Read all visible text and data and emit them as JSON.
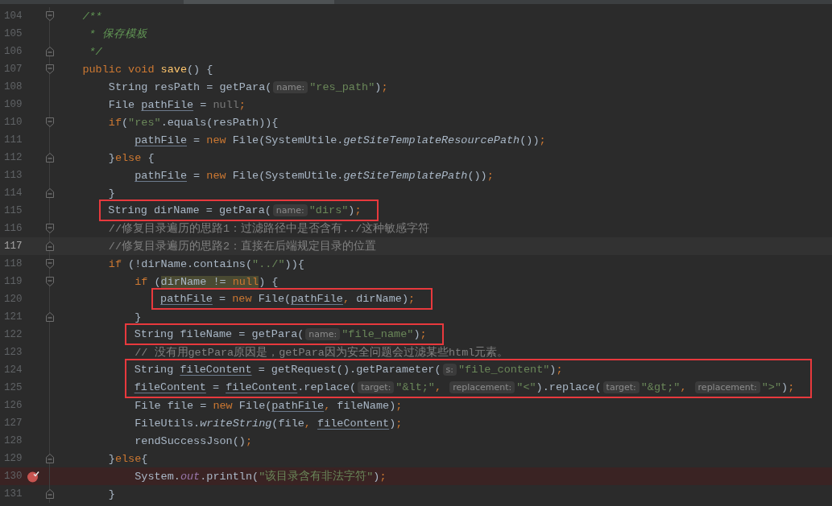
{
  "lines": [
    {
      "kind": "line",
      "number": "104",
      "fold_start": true,
      "fold_end": false,
      "current": false,
      "breakpoint": false,
      "tokens": [
        {
          "text": "/**",
          "kind": "doc"
        }
      ]
    },
    {
      "kind": "line",
      "number": "105",
      "fold_start": false,
      "fold_end": false,
      "current": false,
      "breakpoint": false,
      "tokens": [
        {
          "text": " * 保存模板",
          "kind": "doc"
        }
      ]
    },
    {
      "kind": "line",
      "number": "106",
      "fold_start": false,
      "fold_end": true,
      "current": false,
      "breakpoint": false,
      "tokens": [
        {
          "text": " */",
          "kind": "doc"
        }
      ]
    },
    {
      "kind": "line",
      "number": "107",
      "fold_start": true,
      "fold_end": false,
      "current": false,
      "breakpoint": false,
      "tokens": [
        {
          "text": "public void ",
          "kind": "keyword"
        },
        {
          "text": "save",
          "kind": "decl"
        },
        {
          "text": "() {",
          "kind": "plain"
        }
      ],
      "children": [
        {
          "kind": "line",
          "number": "108",
          "fold_start": false,
          "fold_end": false,
          "current": false,
          "breakpoint": false,
          "tokens": [
            {
              "text": "String resPath = getPara(",
              "kind": "plain"
            },
            {
              "text": "name:",
              "kind": "hint"
            },
            {
              "text": "\"res_path\"",
              "kind": "string"
            },
            {
              "text": ")",
              "kind": "plain"
            },
            {
              "text": ";",
              "kind": "punct"
            }
          ]
        },
        {
          "kind": "line",
          "number": "109",
          "fold_start": false,
          "fold_end": false,
          "current": false,
          "breakpoint": false,
          "tokens": [
            {
              "text": "File ",
              "kind": "plain"
            },
            {
              "text": "pathFile",
              "kind": "var"
            },
            {
              "text": " = ",
              "kind": "plain"
            },
            {
              "text": "null",
              "kind": "unused"
            },
            {
              "text": ";",
              "kind": "punct"
            }
          ]
        },
        {
          "kind": "line",
          "number": "110",
          "fold_start": true,
          "fold_end": false,
          "current": false,
          "breakpoint": false,
          "tokens": [
            {
              "text": "if",
              "kind": "keyword"
            },
            {
              "text": "(",
              "kind": "plain"
            },
            {
              "text": "\"res\"",
              "kind": "string"
            },
            {
              "text": ".equals(resPath)){",
              "kind": "plain"
            }
          ],
          "children": [
            {
              "kind": "line",
              "number": "111",
              "fold_start": false,
              "fold_end": false,
              "current": false,
              "breakpoint": false,
              "tokens": [
                {
                  "text": "pathFile",
                  "kind": "var"
                },
                {
                  "text": " = ",
                  "kind": "plain"
                },
                {
                  "text": "new ",
                  "kind": "keyword"
                },
                {
                  "text": "File(SystemUtile.",
                  "kind": "plain"
                },
                {
                  "text": "getSiteTemplateResourcePath",
                  "kind": "italic"
                },
                {
                  "text": "())",
                  "kind": "plain"
                },
                {
                  "text": ";",
                  "kind": "punct"
                }
              ]
            }
          ]
        },
        {
          "kind": "line",
          "number": "112",
          "fold_start": false,
          "fold_end": true,
          "current": false,
          "breakpoint": false,
          "tokens": [
            {
              "text": "}",
              "kind": "plain"
            },
            {
              "text": "else",
              "kind": "keyword"
            },
            {
              "text": " {",
              "kind": "plain"
            }
          ],
          "children": [
            {
              "kind": "line",
              "number": "113",
              "fold_start": false,
              "fold_end": false,
              "current": false,
              "breakpoint": false,
              "tokens": [
                {
                  "text": "pathFile",
                  "kind": "var"
                },
                {
                  "text": " = ",
                  "kind": "plain"
                },
                {
                  "text": "new ",
                  "kind": "keyword"
                },
                {
                  "text": "File(SystemUtile.",
                  "kind": "plain"
                },
                {
                  "text": "getSiteTemplatePath",
                  "kind": "italic"
                },
                {
                  "text": "())",
                  "kind": "plain"
                },
                {
                  "text": ";",
                  "kind": "punct"
                }
              ]
            }
          ]
        },
        {
          "kind": "line",
          "number": "114",
          "fold_start": false,
          "fold_end": true,
          "current": false,
          "breakpoint": false,
          "tokens": [
            {
              "text": "}",
              "kind": "plain"
            }
          ]
        },
        {
          "kind": "boxed",
          "lines": [
            {
              "number": "115",
              "fold_start": false,
              "fold_end": false,
              "current": false,
              "breakpoint": false,
              "tokens": [
                {
                  "text": "String dirName = getPara(",
                  "kind": "plain"
                },
                {
                  "text": "name:",
                  "kind": "hint"
                },
                {
                  "text": "\"dirs\"",
                  "kind": "string"
                },
                {
                  "text": ")",
                  "kind": "plain"
                },
                {
                  "text": ";",
                  "kind": "punct"
                }
              ]
            }
          ]
        },
        {
          "kind": "line",
          "number": "116",
          "fold_start": true,
          "fold_end": false,
          "current": false,
          "breakpoint": false,
          "tokens": [
            {
              "text": "//修复目录遍历的思路1：过滤路径中是否含有../这种敏感字符",
              "kind": "comment"
            }
          ]
        },
        {
          "kind": "line",
          "number": "117",
          "fold_start": false,
          "fold_end": true,
          "current": true,
          "breakpoint": false,
          "tokens": [
            {
              "text": "//修复目录遍历的思路2：直接在后端规定目录的位置",
              "kind": "comment"
            }
          ]
        },
        {
          "kind": "line",
          "number": "118",
          "fold_start": true,
          "fold_end": false,
          "current": false,
          "breakpoint": false,
          "tokens": [
            {
              "text": "if",
              "kind": "keyword"
            },
            {
              "text": " (!dirName.contains(",
              "kind": "plain"
            },
            {
              "text": "\"../\"",
              "kind": "string"
            },
            {
              "text": ")){",
              "kind": "plain"
            }
          ],
          "children": [
            {
              "kind": "line",
              "number": "119",
              "fold_start": true,
              "fold_end": false,
              "current": false,
              "breakpoint": false,
              "tokens": [
                {
                  "text": "if",
                  "kind": "keyword",
                  "marked": false
                },
                {
                  "text": " (",
                  "kind": "plain",
                  "marked": false
                },
                {
                  "text": "dirName != ",
                  "kind": "plain",
                  "marked": true
                },
                {
                  "text": "null",
                  "kind": "keyword",
                  "marked": true
                },
                {
                  "text": ") {",
                  "kind": "plain",
                  "marked": false
                }
              ],
              "children": [
                {
                  "kind": "boxed",
                  "lines": [
                    {
                      "number": "120",
                      "fold_start": false,
                      "fold_end": false,
                      "current": false,
                      "breakpoint": false,
                      "tokens": [
                        {
                          "text": "pathFile",
                          "kind": "var"
                        },
                        {
                          "text": " = ",
                          "kind": "plain"
                        },
                        {
                          "text": "new ",
                          "kind": "keyword"
                        },
                        {
                          "text": "File(",
                          "kind": "plain"
                        },
                        {
                          "text": "pathFile",
                          "kind": "var"
                        },
                        {
                          "text": ", ",
                          "kind": "punct"
                        },
                        {
                          "text": "dirName)",
                          "kind": "plain"
                        },
                        {
                          "text": ";",
                          "kind": "punct"
                        }
                      ]
                    }
                  ]
                }
              ]
            },
            {
              "kind": "line",
              "number": "121",
              "fold_start": false,
              "fold_end": true,
              "current": false,
              "breakpoint": false,
              "tokens": [
                {
                  "text": "}",
                  "kind": "plain"
                }
              ]
            },
            {
              "kind": "boxed",
              "lines": [
                {
                  "number": "122",
                  "fold_start": false,
                  "fold_end": false,
                  "current": false,
                  "breakpoint": false,
                  "tokens": [
                    {
                      "text": "String fileName = getPara(",
                      "kind": "plain"
                    },
                    {
                      "text": "name:",
                      "kind": "hint"
                    },
                    {
                      "text": "\"file_name\"",
                      "kind": "string"
                    },
                    {
                      "text": ")",
                      "kind": "plain"
                    },
                    {
                      "text": ";",
                      "kind": "punct"
                    }
                  ]
                }
              ]
            },
            {
              "kind": "line",
              "number": "123",
              "fold_start": false,
              "fold_end": false,
              "current": false,
              "breakpoint": false,
              "tokens": [
                {
                  "text": "// 没有用getPara原因是，getPara因为安全问题会过滤某些html元素。",
                  "kind": "comment"
                }
              ]
            },
            {
              "kind": "boxed",
              "lines": [
                {
                  "number": "124",
                  "fold_start": false,
                  "fold_end": false,
                  "current": false,
                  "breakpoint": false,
                  "tokens": [
                    {
                      "text": "String ",
                      "kind": "plain"
                    },
                    {
                      "text": "fileContent",
                      "kind": "var"
                    },
                    {
                      "text": " = getRequest().getParameter(",
                      "kind": "plain"
                    },
                    {
                      "text": "s:",
                      "kind": "hint"
                    },
                    {
                      "text": "\"file_content\"",
                      "kind": "string"
                    },
                    {
                      "text": ")",
                      "kind": "plain"
                    },
                    {
                      "text": ";",
                      "kind": "punct"
                    }
                  ]
                },
                {
                  "number": "125",
                  "fold_start": false,
                  "fold_end": false,
                  "current": false,
                  "breakpoint": false,
                  "tokens": [
                    {
                      "text": "fileContent",
                      "kind": "var"
                    },
                    {
                      "text": " = ",
                      "kind": "plain"
                    },
                    {
                      "text": "fileContent",
                      "kind": "var"
                    },
                    {
                      "text": ".replace(",
                      "kind": "plain"
                    },
                    {
                      "text": "target:",
                      "kind": "hint"
                    },
                    {
                      "text": "\"&lt;\"",
                      "kind": "string"
                    },
                    {
                      "text": ", ",
                      "kind": "punct"
                    },
                    {
                      "text": "replacement:",
                      "kind": "hint"
                    },
                    {
                      "text": "\"<\"",
                      "kind": "string"
                    },
                    {
                      "text": ").replace(",
                      "kind": "plain"
                    },
                    {
                      "text": "target:",
                      "kind": "hint"
                    },
                    {
                      "text": "\"&gt;\"",
                      "kind": "string"
                    },
                    {
                      "text": ", ",
                      "kind": "punct"
                    },
                    {
                      "text": "replacement:",
                      "kind": "hint"
                    },
                    {
                      "text": "\">\"",
                      "kind": "string"
                    },
                    {
                      "text": ")",
                      "kind": "plain"
                    },
                    {
                      "text": ";",
                      "kind": "punct"
                    }
                  ]
                }
              ]
            },
            {
              "kind": "line",
              "number": "126",
              "fold_start": false,
              "fold_end": false,
              "current": false,
              "breakpoint": false,
              "tokens": [
                {
                  "text": "File file = ",
                  "kind": "plain"
                },
                {
                  "text": "new ",
                  "kind": "keyword"
                },
                {
                  "text": "File(",
                  "kind": "plain"
                },
                {
                  "text": "pathFile",
                  "kind": "var"
                },
                {
                  "text": ", ",
                  "kind": "punct"
                },
                {
                  "text": "fileName)",
                  "kind": "plain"
                },
                {
                  "text": ";",
                  "kind": "punct"
                }
              ]
            },
            {
              "kind": "line",
              "number": "127",
              "fold_start": false,
              "fold_end": false,
              "current": false,
              "breakpoint": false,
              "tokens": [
                {
                  "text": "FileUtils.",
                  "kind": "plain"
                },
                {
                  "text": "writeString",
                  "kind": "italic"
                },
                {
                  "text": "(file",
                  "kind": "plain"
                },
                {
                  "text": ", ",
                  "kind": "punct"
                },
                {
                  "text": "fileContent",
                  "kind": "var"
                },
                {
                  "text": ")",
                  "kind": "plain"
                },
                {
                  "text": ";",
                  "kind": "punct"
                }
              ]
            },
            {
              "kind": "line",
              "number": "128",
              "fold_start": false,
              "fold_end": false,
              "current": false,
              "breakpoint": false,
              "tokens": [
                {
                  "text": "rendSuccessJson()",
                  "kind": "plain"
                },
                {
                  "text": ";",
                  "kind": "punct"
                }
              ]
            }
          ]
        },
        {
          "kind": "line",
          "number": "129",
          "fold_start": false,
          "fold_end": true,
          "current": false,
          "breakpoint": false,
          "tokens": [
            {
              "text": "}",
              "kind": "plain"
            },
            {
              "text": "else",
              "kind": "keyword"
            },
            {
              "text": "{",
              "kind": "plain"
            }
          ],
          "children": [
            {
              "kind": "line",
              "number": "130",
              "fold_start": false,
              "fold_end": false,
              "current": false,
              "breakpoint": true,
              "tokens": [
                {
                  "text": "System.",
                  "kind": "plain"
                },
                {
                  "text": "out",
                  "kind": "static"
                },
                {
                  "text": ".println(",
                  "kind": "plain"
                },
                {
                  "text": "\"该目录含有非法字符\"",
                  "kind": "string"
                },
                {
                  "text": ")",
                  "kind": "plain"
                },
                {
                  "text": ";",
                  "kind": "punct"
                }
              ]
            }
          ]
        },
        {
          "kind": "line",
          "number": "131",
          "fold_start": false,
          "fold_end": true,
          "current": false,
          "breakpoint": false,
          "tokens": [
            {
              "text": "}",
              "kind": "plain"
            }
          ]
        }
      ]
    }
  ]
}
